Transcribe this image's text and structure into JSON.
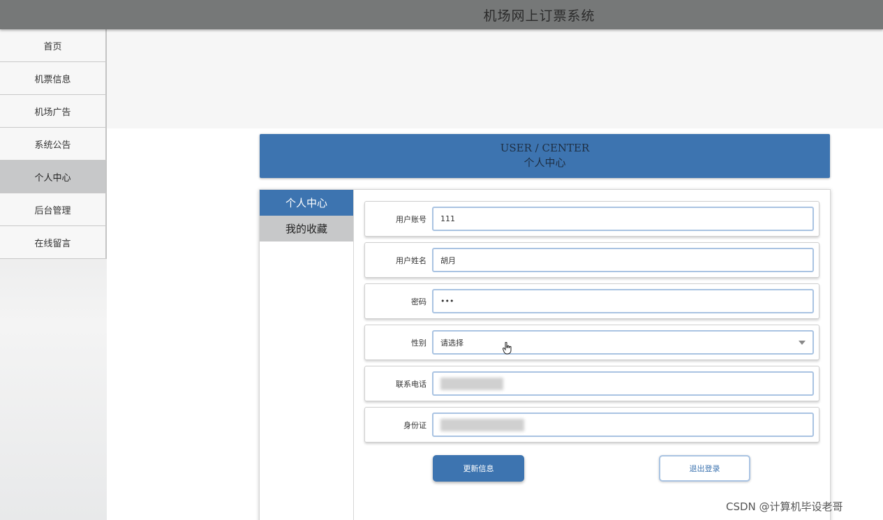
{
  "header": {
    "title": "机场网上订票系统"
  },
  "sidebar": {
    "items": [
      {
        "label": "首页",
        "active": false
      },
      {
        "label": "机票信息",
        "active": false
      },
      {
        "label": "机场广告",
        "active": false
      },
      {
        "label": "系统公告",
        "active": false
      },
      {
        "label": "个人中心",
        "active": true
      },
      {
        "label": "后台管理",
        "active": false
      },
      {
        "label": "在线留言",
        "active": false
      }
    ]
  },
  "page_title": {
    "en": "USER / CENTER",
    "cn": "个人中心"
  },
  "tabs": [
    {
      "label": "个人中心",
      "active": true
    },
    {
      "label": "我的收藏",
      "active": false
    }
  ],
  "form": {
    "account": {
      "label": "用户账号",
      "value": "111"
    },
    "name": {
      "label": "用户姓名",
      "value": "胡月"
    },
    "password": {
      "label": "密码",
      "value": "•••"
    },
    "gender": {
      "label": "性别",
      "value": "请选择"
    },
    "phone": {
      "label": "联系电话"
    },
    "idcard": {
      "label": "身份证"
    }
  },
  "buttons": {
    "update": "更新信息",
    "logout": "退出登录"
  },
  "watermark": "CSDN @计算机毕设老哥",
  "colors": {
    "accent": "#3d74b0",
    "topbar": "#767878",
    "active_nav": "#c7c8c9"
  }
}
